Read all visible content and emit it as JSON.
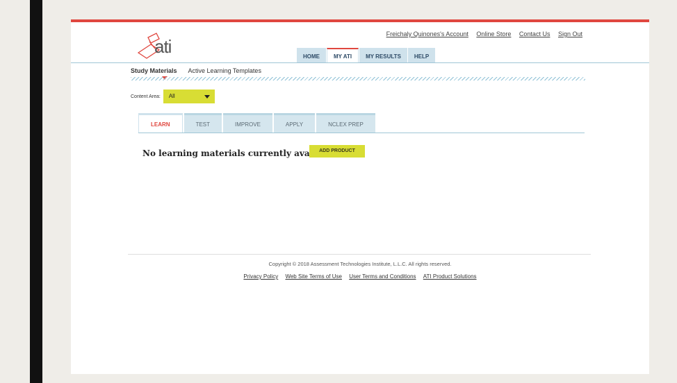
{
  "brand": {
    "logo_text": "ati"
  },
  "account_links": [
    "Freichaly Quinones's Account",
    "Online Store",
    "Contact Us",
    "Sign Out"
  ],
  "main_nav": {
    "home": "HOME",
    "my_ati": "MY ATI",
    "my_results": "MY RESULTS",
    "help": "HELP",
    "active": "MY ATI"
  },
  "sub_nav": {
    "study_materials": "Study Materials",
    "active_learning_templates": "Active Learning Templates"
  },
  "content_area": {
    "label": "Content Area:",
    "selected": "All"
  },
  "sub_tabs": {
    "learn": "LEARN",
    "test": "TEST",
    "improve": "IMPROVE",
    "apply": "APPLY",
    "nclex_prep": "NCLEX PREP",
    "active": "LEARN"
  },
  "main": {
    "empty_message": "No learning materials currently available",
    "add_product_label": "ADD PRODUCT"
  },
  "footer": {
    "copyright": "Copyright © 2018 Assessment Technologies Institute, L.L.C. All rights reserved.",
    "links": [
      "Privacy Policy",
      "Web Site Terms of Use",
      "User Terms and Conditions",
      "ATI Product Solutions"
    ]
  },
  "colors": {
    "accent": "#e0473f",
    "button": "#d8dd34",
    "tab_bg": "#cfe2ec"
  }
}
